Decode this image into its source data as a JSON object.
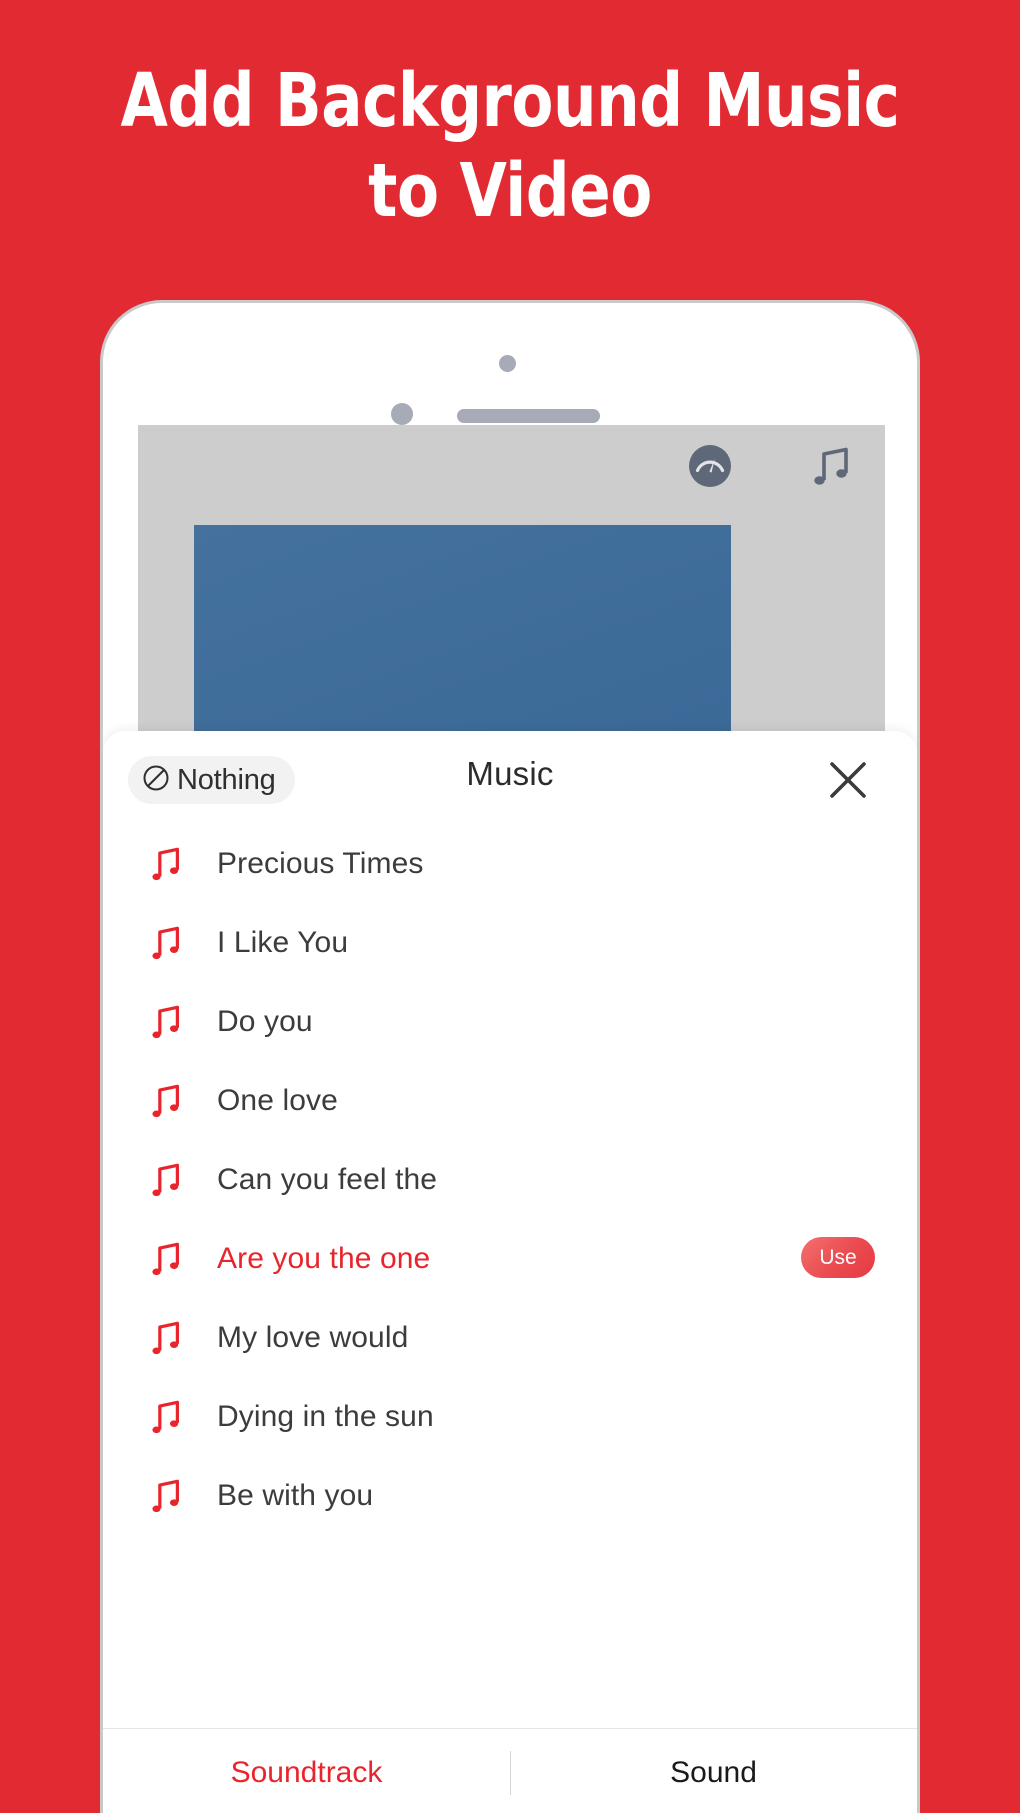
{
  "promo": {
    "title_line1": "Add Background Music",
    "title_line2": "to Video",
    "background_color": "#e22a32"
  },
  "editor": {
    "toolbar": {
      "speed_icon": "speedometer-icon",
      "music_icon": "music-note-icon"
    },
    "preview_color": "#3d6b98",
    "canvas_color": "#cdcdcd"
  },
  "sheet": {
    "title": "Music",
    "nothing_label": "Nothing",
    "nothing_icon": "no-sound-icon",
    "close_icon": "close-icon",
    "songs": [
      {
        "title": "Precious Times",
        "selected": false,
        "action": ""
      },
      {
        "title": "I Like You",
        "selected": false,
        "action": ""
      },
      {
        "title": "Do you",
        "selected": false,
        "action": ""
      },
      {
        "title": "One love",
        "selected": false,
        "action": ""
      },
      {
        "title": "Can you feel the",
        "selected": false,
        "action": ""
      },
      {
        "title": "Are you the one",
        "selected": true,
        "action": "Use"
      },
      {
        "title": "My love would",
        "selected": false,
        "action": ""
      },
      {
        "title": "Dying in the sun",
        "selected": false,
        "action": ""
      },
      {
        "title": "Be with you",
        "selected": false,
        "action": ""
      }
    ],
    "tabs": [
      {
        "label": "Soundtrack",
        "active": true
      },
      {
        "label": "Sound",
        "active": false
      }
    ],
    "accent_color": "#e8252c"
  }
}
